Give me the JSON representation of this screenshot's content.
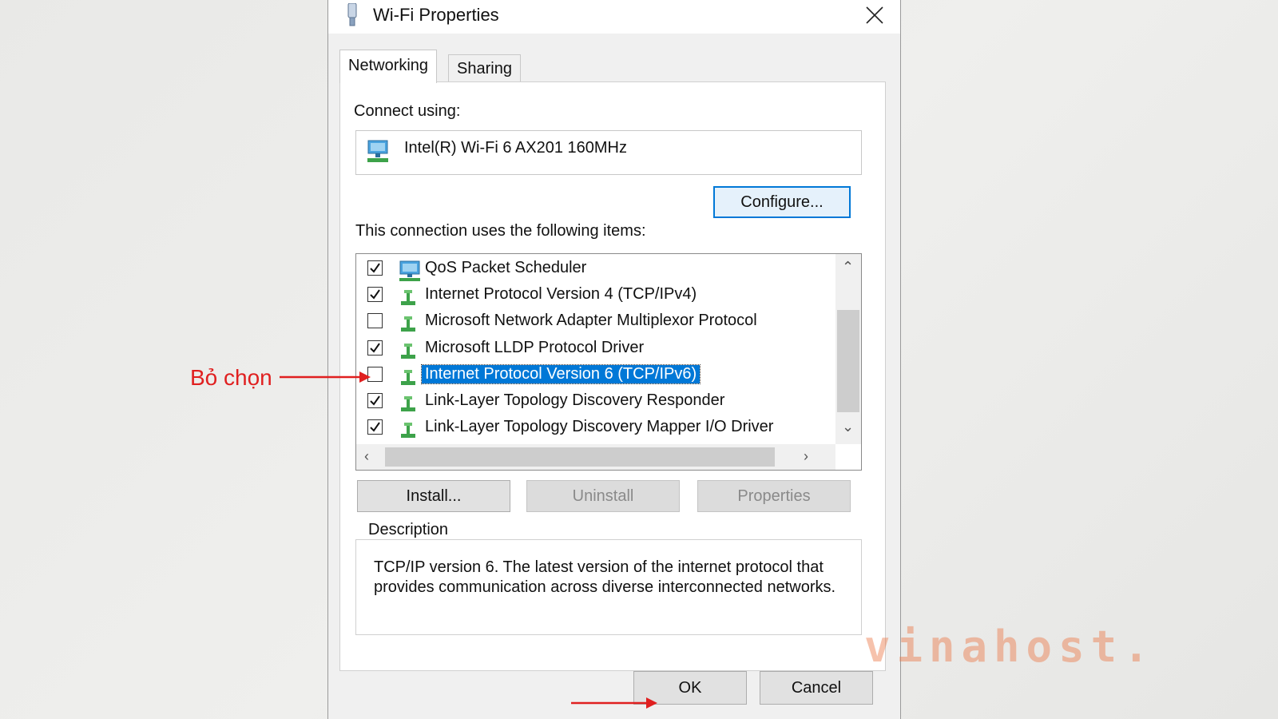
{
  "window": {
    "title": "Wi-Fi Properties"
  },
  "tabs": [
    {
      "label": "Networking",
      "active": true
    },
    {
      "label": "Sharing",
      "active": false
    }
  ],
  "connect_using": {
    "label": "Connect using:",
    "adapter": "Intel(R) Wi-Fi 6 AX201 160MHz"
  },
  "buttons": {
    "configure": "Configure...",
    "install": "Install...",
    "uninstall": "Uninstall",
    "properties": "Properties",
    "ok": "OK",
    "cancel": "Cancel"
  },
  "items_label": "This connection uses the following items:",
  "items": [
    {
      "label": "QoS Packet Scheduler",
      "checked": true,
      "icon": "network-monitor-icon"
    },
    {
      "label": "Internet Protocol Version 4 (TCP/IPv4)",
      "checked": true,
      "icon": "protocol-icon"
    },
    {
      "label": "Microsoft Network Adapter Multiplexor Protocol",
      "checked": false,
      "icon": "protocol-icon"
    },
    {
      "label": "Microsoft LLDP Protocol Driver",
      "checked": true,
      "icon": "protocol-icon"
    },
    {
      "label": "Internet Protocol Version 6 (TCP/IPv6)",
      "checked": false,
      "icon": "protocol-icon",
      "selected": true
    },
    {
      "label": "Link-Layer Topology Discovery Responder",
      "checked": true,
      "icon": "protocol-icon"
    },
    {
      "label": "Link-Layer Topology Discovery Mapper I/O Driver",
      "checked": true,
      "icon": "protocol-icon"
    }
  ],
  "description": {
    "legend": "Description",
    "text": "TCP/IP version 6. The latest version of the internet protocol that provides communication across diverse interconnected networks."
  },
  "annotation": {
    "label": "Bỏ chọn",
    "color": "#e02020"
  },
  "watermark": "vinahost.",
  "colors": {
    "selection": "#0078d7",
    "focus_border": "#0078d7",
    "annotation": "#e02020"
  }
}
